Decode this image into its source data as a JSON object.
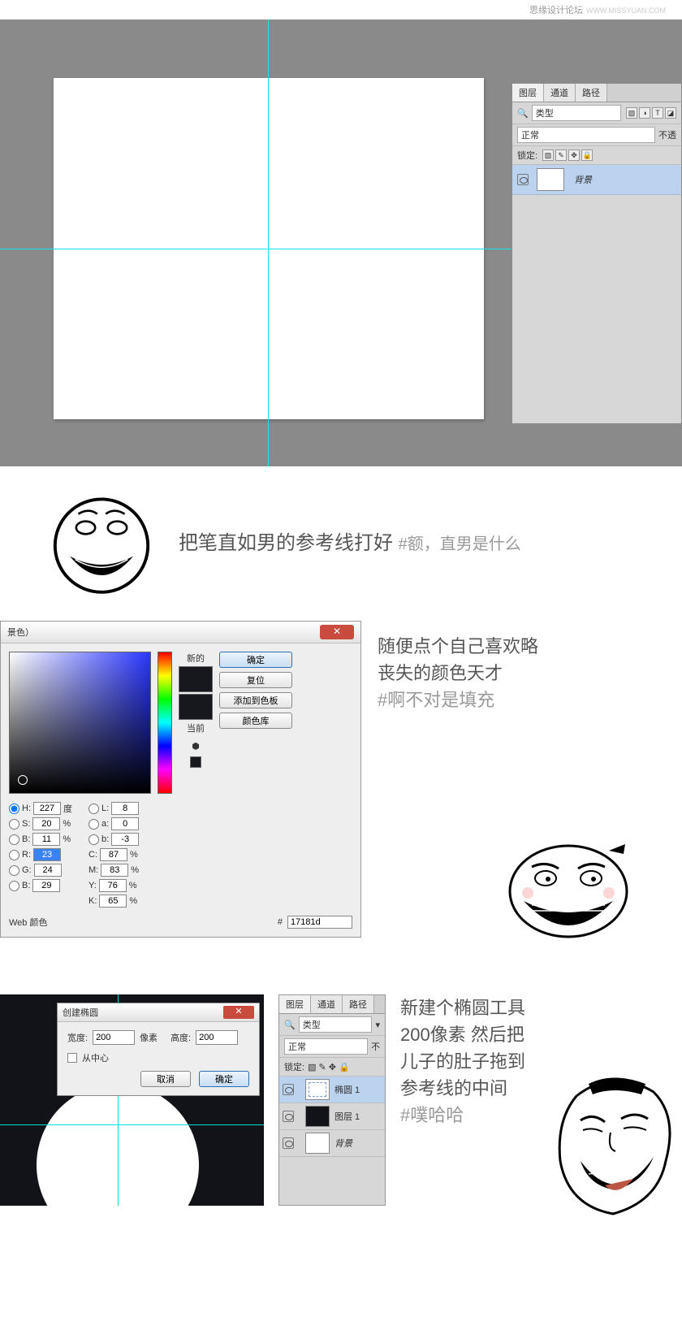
{
  "watermark": {
    "text": "思缘设计论坛",
    "site": "WWW.MISSYUAN.COM"
  },
  "section1": {
    "layers_panel": {
      "tabs": [
        "图层",
        "通道",
        "路径"
      ],
      "type_select": "类型",
      "blend_select": "正常",
      "opacity_label": "不透",
      "lock_label": "锁定:",
      "layer": {
        "name": "背景"
      }
    },
    "caption_main": "把笔直如男的参考线打好",
    "caption_hash": "#额，直男是什么"
  },
  "section2": {
    "picker": {
      "title_suffix": "景色）",
      "new_label": "新的",
      "current_label": "当前",
      "web_label": "Web 颜色",
      "buttons": {
        "ok": "确定",
        "reset": "复位",
        "add": "添加到色板",
        "library": "颜色库"
      },
      "hsb": {
        "H": "227",
        "H_unit": "度",
        "S": "20",
        "B": "11"
      },
      "rgb": {
        "R": "23",
        "G": "24",
        "Bl": "29"
      },
      "lab": {
        "L": "8",
        "a": "0",
        "b": "-3"
      },
      "cmyk": {
        "C": "87",
        "M": "83",
        "Y": "76",
        "K": "65"
      },
      "hex": "17181d",
      "pct": "%"
    },
    "caption_l1": "随便点个自己喜欢略",
    "caption_l2": "丧失的颜色天才",
    "caption_hash": "#啊不对是填充"
  },
  "section3": {
    "ellipse": {
      "title": "创建椭圆",
      "width_label": "宽度:",
      "width_val": "200",
      "width_unit": "像素",
      "height_label": "高度:",
      "height_val": "200",
      "center_label": "从中心",
      "cancel": "取消",
      "ok": "确定"
    },
    "layers": {
      "tabs": [
        "图层",
        "通道",
        "路径"
      ],
      "type": "类型",
      "blend": "正常",
      "lock": "锁定:",
      "opacity": "不",
      "items": [
        {
          "name": "椭圆 1"
        },
        {
          "name": "图层 1"
        },
        {
          "name": "背景"
        }
      ]
    },
    "caption_l1": "新建个椭圆工具",
    "caption_l2": "200像素 然后把",
    "caption_l3": "儿子的肚子拖到",
    "caption_l4": "参考线的中间",
    "caption_hash": "#噗哈哈"
  }
}
